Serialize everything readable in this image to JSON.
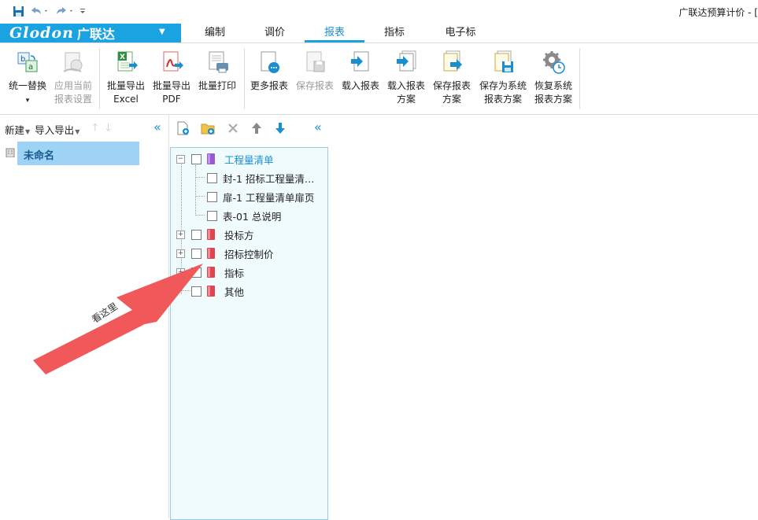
{
  "app": {
    "title": "广联达预算计价 - [",
    "logo_brand": "Glodon",
    "logo_cn": "广联达"
  },
  "icons": {
    "save": "save-icon",
    "undo": "undo-icon",
    "redo": "redo-icon",
    "customize": "customize-quick-access-icon"
  },
  "tabs": [
    {
      "label": "编制",
      "active": false
    },
    {
      "label": "调价",
      "active": false
    },
    {
      "label": "报表",
      "active": true
    },
    {
      "label": "指标",
      "active": false
    },
    {
      "label": "电子标",
      "active": false
    }
  ],
  "toolbar": [
    {
      "line1": "统一替换",
      "line2": "▾",
      "icon": "unify-replace-icon",
      "enabled": true
    },
    {
      "line1": "应用当前",
      "line2": "报表设置",
      "icon": "apply-settings-icon",
      "enabled": false
    },
    {
      "line1": "批量导出",
      "line2": "Excel",
      "icon": "excel-export-icon",
      "enabled": true
    },
    {
      "line1": "批量导出",
      "line2": "PDF",
      "icon": "pdf-export-icon",
      "enabled": true
    },
    {
      "line1": "批量打印",
      "line2": "",
      "icon": "batch-print-icon",
      "enabled": true
    },
    {
      "line1": "更多报表",
      "line2": "",
      "icon": "more-reports-icon",
      "enabled": true
    },
    {
      "line1": "保存报表",
      "line2": "",
      "icon": "save-report-icon",
      "enabled": false
    },
    {
      "line1": "载入报表",
      "line2": "",
      "icon": "load-report-icon",
      "enabled": true
    },
    {
      "line1": "载入报表",
      "line2": "方案",
      "icon": "load-scheme-icon",
      "enabled": true
    },
    {
      "line1": "保存报表",
      "line2": "方案",
      "icon": "save-scheme-icon",
      "enabled": true
    },
    {
      "line1": "保存为系统",
      "line2": "报表方案",
      "icon": "save-system-scheme-icon",
      "enabled": true
    },
    {
      "line1": "恢复系统",
      "line2": "报表方案",
      "icon": "restore-system-scheme-icon",
      "enabled": true
    }
  ],
  "left_panel": {
    "new_label": "新建",
    "import_export_label": "导入导出",
    "project_name": "未命名"
  },
  "tree": {
    "root": {
      "label": "工程量清单",
      "children": [
        "封-1 招标工程量清…",
        "扉-1 工程量清单扉页",
        "表-01 总说明"
      ]
    },
    "groups": [
      "投标方",
      "招标控制价",
      "指标",
      "其他"
    ]
  },
  "annotation": {
    "text": "看这里",
    "color": "#f0585a"
  }
}
